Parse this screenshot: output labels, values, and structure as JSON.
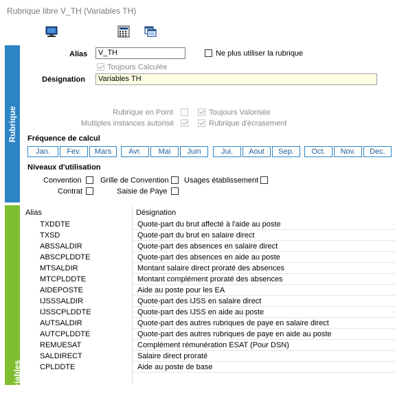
{
  "window": {
    "title": "Rubrique libre V_TH (Variables TH)"
  },
  "toolbar": {
    "icons": [
      "monitor-icon",
      "calculator-icon",
      "windows-icon"
    ]
  },
  "tabs": {
    "rubrique": "Rubrique",
    "variables": "Variables"
  },
  "form": {
    "alias_label": "Alias",
    "alias_value": "V_TH",
    "ne_plus_utiliser_label": "Ne plus utiliser la rubrique",
    "toujours_calculee_label": "Toujours Calculée",
    "designation_label": "Désignation",
    "designation_value": "Variables TH",
    "rubrique_en_point_label": "Rubrique en Point",
    "toujours_valorisee_label": "Toujours Valorisée",
    "multiples_instances_label": "Multiples instances autorisé",
    "rubrique_ecrasement_label": "Rubrique d'écrasement"
  },
  "frequence": {
    "label": "Fréquence de calcul",
    "months": [
      "Jan.",
      "Fev.",
      "Mars",
      "Avr.",
      "Mai",
      "Juin",
      "Jui.",
      "Aout",
      "Sep.",
      "Oct.",
      "Nov.",
      "Dec."
    ]
  },
  "niveaux": {
    "label": "Niveaux d'utilisation",
    "convention": "Convention",
    "grille": "Grille de Convention",
    "usages": "Usages établissement",
    "contrat": "Contrat",
    "saisie": "Saisie de Paye"
  },
  "grid": {
    "columns": [
      "Alias",
      "Désignation"
    ],
    "rows": [
      [
        "TXDDTE",
        "Quote-part du brut affecté à l'aide au poste"
      ],
      [
        "TXSD",
        "Quote-part du brut en salaire direct"
      ],
      [
        "ABSSALDIR",
        "Quote-part des absences en salaire direct"
      ],
      [
        "ABSCPLDDTE",
        "Quote-part des absences en aide au poste"
      ],
      [
        "MTSALDIR",
        "Montant salaire direct proraté des absences"
      ],
      [
        "MTCPLDDTE",
        "Montant complément proraté des absences"
      ],
      [
        "AIDEPOSTE",
        "Aide au poste pour les EA"
      ],
      [
        "IJSSSALDIR",
        "Quote-part des IJSS en salaire direct"
      ],
      [
        "IJSSCPLDDTE",
        "Quote-part des IJSS en aide au poste"
      ],
      [
        "AUTSALDIR",
        "Quote-part des autres rubriques de paye en salaire direct"
      ],
      [
        "AUTCPLDDTE",
        "Quote-part des autres rubriques de paye en aide au poste"
      ],
      [
        "REMUESAT",
        "Complément rémunération ESAT (Pour DSN)"
      ],
      [
        "SALDIRECT",
        "Salaire direct proraté"
      ],
      [
        "CPLDDTE",
        "Aide au poste de base"
      ]
    ]
  }
}
